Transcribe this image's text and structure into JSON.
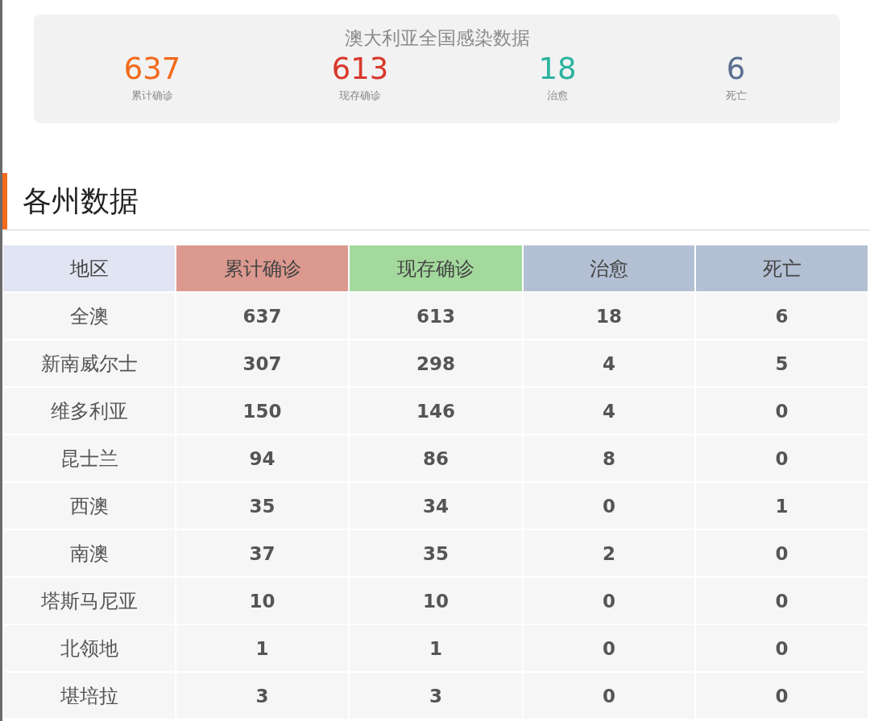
{
  "summary": {
    "title": "澳大利亚全国感染数据",
    "stats": [
      {
        "value": "637",
        "label": "累计确诊",
        "color": "#f26a1b"
      },
      {
        "value": "613",
        "label": "现存确诊",
        "color": "#d9382c"
      },
      {
        "value": "18",
        "label": "治愈",
        "color": "#2bb3a0"
      },
      {
        "value": "6",
        "label": "死亡",
        "color": "#5a6e91"
      }
    ]
  },
  "section": {
    "title": "各州数据"
  },
  "table": {
    "columns": [
      {
        "label": "地区",
        "color": "#e1e4f2"
      },
      {
        "label": "累计确诊",
        "color": "#dc998f"
      },
      {
        "label": "现存确诊",
        "color": "#a3d99c"
      },
      {
        "label": "治愈",
        "color": "#b3bfd3"
      },
      {
        "label": "死亡",
        "color": "#b3bfd3"
      }
    ],
    "rows": [
      [
        "全澳",
        "637",
        "613",
        "18",
        "6"
      ],
      [
        "新南威尔士",
        "307",
        "298",
        "4",
        "5"
      ],
      [
        "维多利亚",
        "150",
        "146",
        "4",
        "0"
      ],
      [
        "昆士兰",
        "94",
        "86",
        "8",
        "0"
      ],
      [
        "西澳",
        "35",
        "34",
        "0",
        "1"
      ],
      [
        "南澳",
        "37",
        "35",
        "2",
        "0"
      ],
      [
        "塔斯马尼亚",
        "10",
        "10",
        "0",
        "0"
      ],
      [
        "北领地",
        "1",
        "1",
        "0",
        "0"
      ],
      [
        "堪培拉",
        "3",
        "3",
        "0",
        "0"
      ]
    ]
  }
}
